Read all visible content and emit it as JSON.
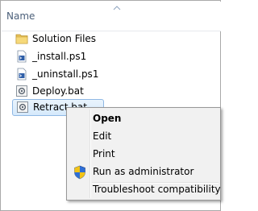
{
  "header": {
    "name_col": "Name"
  },
  "files": [
    {
      "label": "Solution Files",
      "icon": "folder-icon"
    },
    {
      "label": "_install.ps1",
      "icon": "ps1-file-icon"
    },
    {
      "label": "_uninstall.ps1",
      "icon": "ps1-file-icon"
    },
    {
      "label": "Deploy.bat",
      "icon": "bat-file-icon"
    },
    {
      "label": "Retract.bat",
      "icon": "bat-file-icon"
    }
  ],
  "menu": {
    "items": [
      {
        "label": "Open",
        "default": true
      },
      {
        "label": "Edit"
      },
      {
        "label": "Print"
      },
      {
        "label": "Run as administrator",
        "icon": "uac-shield-icon"
      },
      {
        "label": "Troubleshoot compatibility"
      }
    ]
  },
  "colors": {
    "selection": "#d5e9fb",
    "selection_border": "#8fb8e4",
    "header_text": "#4c607a",
    "menu_bg": "#f1f1f1"
  }
}
